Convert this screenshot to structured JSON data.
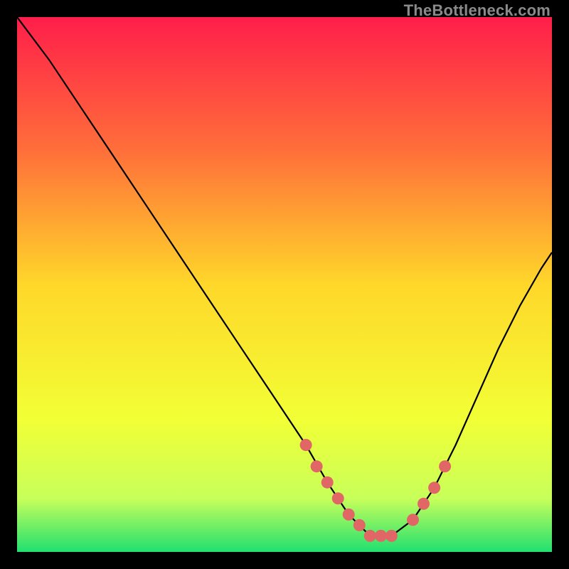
{
  "watermark": "TheBottleneck.com",
  "chart_data": {
    "type": "line",
    "title": "",
    "xlabel": "",
    "ylabel": "",
    "xlim": [
      0,
      100
    ],
    "ylim": [
      0,
      100
    ],
    "grid": false,
    "curve": {
      "name": "bottleneck-curve",
      "description": "V-shaped bottleneck curve; minimum (optimal balance) around x≈62–70, rising steeply on the left and moderately on the right",
      "x": [
        0,
        6,
        12,
        18,
        24,
        30,
        36,
        42,
        48,
        54,
        58,
        62,
        66,
        70,
        74,
        78,
        82,
        86,
        90,
        94,
        98,
        100
      ],
      "y": [
        100,
        92,
        83,
        74,
        65,
        56,
        47,
        38,
        29,
        20,
        13,
        7,
        3,
        3,
        6,
        12,
        20,
        29,
        38,
        46,
        53,
        56
      ]
    },
    "points": {
      "name": "highlighted-samples",
      "x": [
        54,
        56,
        58,
        60,
        62,
        64,
        66,
        68,
        70,
        74,
        76,
        78,
        80
      ],
      "y": [
        20,
        16,
        13,
        10,
        7,
        5,
        3,
        3,
        3,
        6,
        9,
        12,
        16
      ]
    },
    "gradient_stops": [
      {
        "offset": 0.0,
        "color": "#ff1e4a"
      },
      {
        "offset": 0.25,
        "color": "#ff6f3a"
      },
      {
        "offset": 0.5,
        "color": "#ffd72a"
      },
      {
        "offset": 0.75,
        "color": "#f2ff35"
      },
      {
        "offset": 0.9,
        "color": "#c8ff5a"
      },
      {
        "offset": 1.0,
        "color": "#20e070"
      }
    ]
  }
}
